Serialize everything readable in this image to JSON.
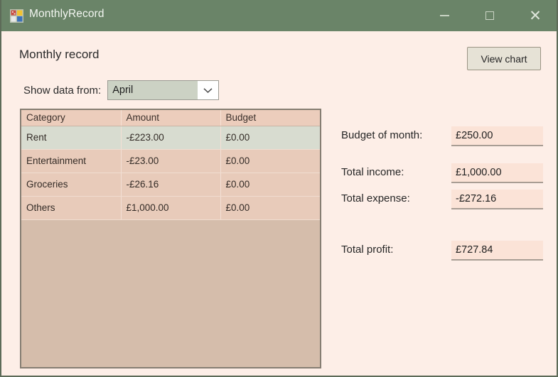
{
  "window": {
    "title": "MonthlyRecord",
    "icon": "app-grid-icon",
    "titlebar_color": "#6a8468",
    "body_color": "#fdeee7",
    "controls": {
      "minimize": "–",
      "maximize": "□",
      "close": "✕"
    }
  },
  "header": {
    "heading": "Monthly record",
    "view_chart_label": "View chart"
  },
  "filter": {
    "label": "Show data from:",
    "selected_month": "April",
    "dropdown_icon": "chevron-down-icon"
  },
  "grid": {
    "columns": [
      "Category",
      "Amount",
      "Budget"
    ],
    "rows": [
      {
        "category": "Rent",
        "amount": "-£223.00",
        "budget": "£0.00",
        "selected": true
      },
      {
        "category": "Entertainment",
        "amount": "-£23.00",
        "budget": "£0.00",
        "selected": false
      },
      {
        "category": "Groceries",
        "amount": "-£26.16",
        "budget": "£0.00",
        "selected": false
      },
      {
        "category": "Others",
        "amount": "£1,000.00",
        "budget": "£0.00",
        "selected": false
      }
    ],
    "header_color": "#eccdbc",
    "row_color": "#e8cbba",
    "selected_row_color": "#d8dcd0",
    "empty_area_color": "#d5bdab"
  },
  "summary": {
    "budget_label": "Budget of month:",
    "budget_value": "£250.00",
    "income_label": "Total income:",
    "income_value": "£1,000.00",
    "expense_label": "Total expense:",
    "expense_value": "-£272.16",
    "profit_label": "Total profit:",
    "profit_value": "£727.84",
    "field_color": "#fbe3d7"
  }
}
